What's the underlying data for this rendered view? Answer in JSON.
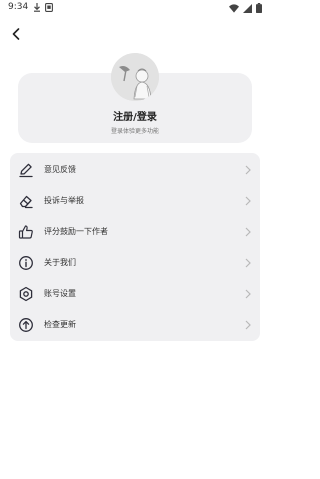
{
  "status_bar": {
    "time": "9:34"
  },
  "profile": {
    "title": "注册/登录",
    "subtitle": "登录体验更多功能"
  },
  "menu": {
    "items": [
      {
        "label": "意见反馈",
        "icon": "edit-pencil-icon"
      },
      {
        "label": "投诉与举报",
        "icon": "eraser-icon"
      },
      {
        "label": "评分鼓励一下作者",
        "icon": "thumbs-up-icon"
      },
      {
        "label": "关于我们",
        "icon": "info-icon"
      },
      {
        "label": "账号设置",
        "icon": "settings-hexagon-icon"
      },
      {
        "label": "检查更新",
        "icon": "update-arrow-icon"
      }
    ]
  },
  "colors": {
    "card_bg": "#f0f0f2",
    "text": "#333333",
    "icon": "#2e2e3a",
    "chevron": "#b8b8b8"
  }
}
